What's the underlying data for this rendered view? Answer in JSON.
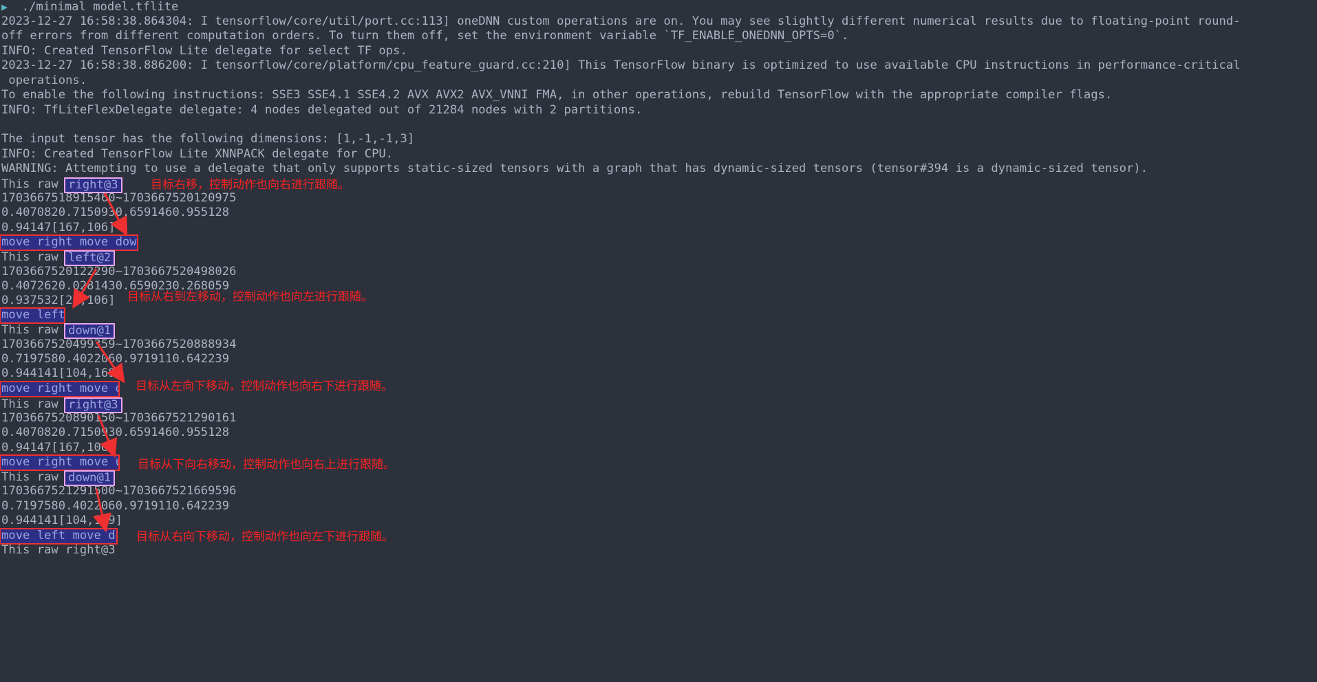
{
  "terminal": {
    "background": "#2c313c",
    "foreground": "#abb2bf",
    "prompt_symbol": "▶",
    "command": "./minimal model.tflite",
    "log_lines": [
      "2023-12-27 16:58:38.864304: I tensorflow/core/util/port.cc:113] oneDNN custom operations are on. You may see slightly different numerical results due to floating-point round-",
      "off errors from different computation orders. To turn them off, set the environment variable `TF_ENABLE_ONEDNN_OPTS=0`.",
      "INFO: Created TensorFlow Lite delegate for select TF ops.",
      "2023-12-27 16:58:38.886200: I tensorflow/core/platform/cpu_feature_guard.cc:210] This TensorFlow binary is optimized to use available CPU instructions in performance-critical",
      " operations.",
      "To enable the following instructions: SSE3 SSE4.1 SSE4.2 AVX AVX2 AVX_VNNI FMA, in other operations, rebuild TensorFlow with the appropriate compiler flags.",
      "INFO: TfLiteFlexDelegate delegate: 4 nodes delegated out of 21284 nodes with 2 partitions.",
      "",
      "The input tensor has the following dimensions: [1,-1,-1,3]",
      "INFO: Created TensorFlow Lite XNNPACK delegate for CPU.",
      "WARNING: Attempting to use a delegate that only supports static-sized tensors with a graph that has dynamic-sized tensors (tensor#394 is a dynamic-sized tensor)."
    ],
    "blocks": [
      {
        "raw_label": "This raw ",
        "token": "right@3",
        "timestamps": "1703667518915460~1703667520120975",
        "scores": "0.4070820.7150930.6591460.955128",
        "coords": "0.94147[167,106]",
        "move": "move right move dow"
      },
      {
        "raw_label": "This raw ",
        "token": "left@2",
        "timestamps": "1703667520122290~1703667520498026",
        "scores": "0.4072620.0281430.6590230.268059",
        "coords": "0.937532[29,106]",
        "move": "move left"
      },
      {
        "raw_label": "This raw ",
        "token": "down@1",
        "timestamps": "1703667520499359~1703667520888934",
        "scores": "0.7197580.4022060.9719110.642239",
        "coords": "0.944141[104,169]",
        "move": "move right move dow"
      },
      {
        "raw_label": "This raw ",
        "token": "right@3",
        "timestamps": "1703667520890150~1703667521290161",
        "scores": "0.4070820.7150930.6591460.955128",
        "coords": "0.94147[167,106]",
        "move": "move right move up"
      },
      {
        "raw_label": "This raw ",
        "token": "down@1",
        "timestamps": "1703667521291500~1703667521669596",
        "scores": "0.7197580.4022060.9719110.642239",
        "coords": "0.944141[104,169]",
        "move": "move left move dow"
      }
    ],
    "last_line": "This raw right@3"
  },
  "annotations": {
    "color": "#fc2222",
    "items": [
      {
        "text": "目标右移，控制动作也向右进行跟随。"
      },
      {
        "text": "目标从右到左移动，控制动作也向左进行跟随。"
      },
      {
        "text": "目标从左向下移动，控制动作也向右下进行跟随。"
      },
      {
        "text": "目标从下向右移动，控制动作也向右上进行跟随。"
      },
      {
        "text": "目标从右向下移动，控制动作也向左下进行跟随。"
      }
    ]
  },
  "highlight_styles": {
    "token_fill": "#2d2f86",
    "token_border": "#e9a7ee",
    "token_text": "#9aa3e0",
    "move_border": "#f03030"
  }
}
